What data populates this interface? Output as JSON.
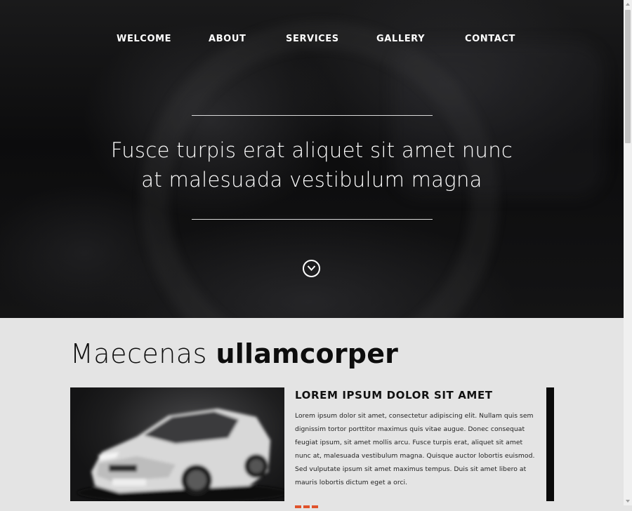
{
  "nav": {
    "items": [
      {
        "label": "WELCOME"
      },
      {
        "label": "ABOUT"
      },
      {
        "label": "SERVICES"
      },
      {
        "label": "GALLERY"
      },
      {
        "label": "CONTACT"
      }
    ]
  },
  "hero": {
    "tagline_line1": "Fusce turpis erat aliquet sit amet nunc",
    "tagline_line2": "at malesuada vestibulum magna",
    "scroll_icon": "chevron-down-icon"
  },
  "section": {
    "title_light": "Maecenas",
    "title_bold": "ullamcorper"
  },
  "card": {
    "heading": "LOREM IPSUM DOLOR SIT AMET",
    "body": "Lorem ipsum dolor sit amet, consectetur adipiscing elit. Nullam quis sem dignissim tortor porttitor maximus quis vitae augue. Donec consequat feugiat ipsum, sit amet mollis arcu. Fusce turpis erat, aliquet sit amet nunc at, malesuada vestibulum magna. Quisque auctor lobortis euismod. Sed vulputate ipsum sit amet maximus tempus. Duis sit amet libero at mauris lobortis dictum eget a orci."
  },
  "colors": {
    "accent": "#e0532c",
    "page_background": "#e4e4e4",
    "hero_background": "#111111"
  }
}
